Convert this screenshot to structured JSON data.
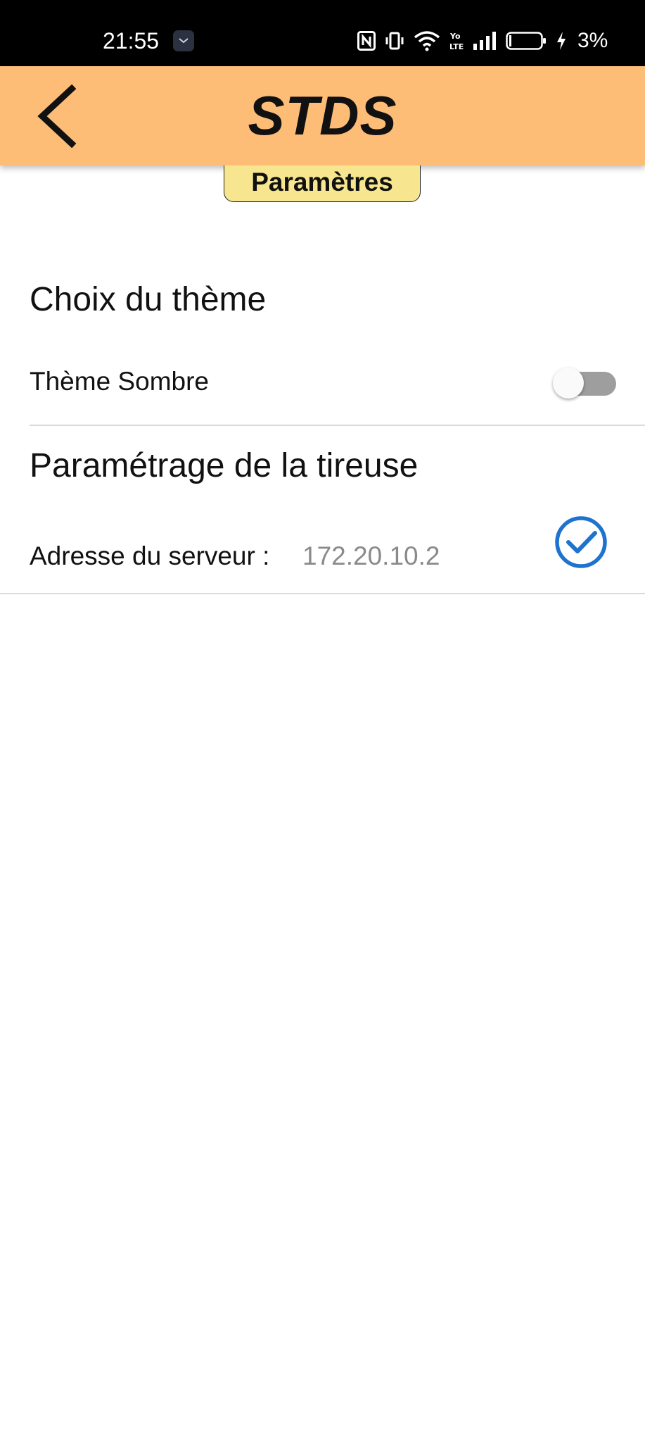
{
  "status_bar": {
    "time": "21:55",
    "battery_percent": "3%",
    "icons": [
      "notification-icon",
      "nfc-icon",
      "vibrate-icon",
      "wifi-icon",
      "volte-icon",
      "signal-icon",
      "battery-icon",
      "charging-icon"
    ]
  },
  "app_bar": {
    "title": "STDS",
    "back_icon": "chevron-left-icon",
    "background": "#fdbd77"
  },
  "page_tab": {
    "label": "Paramètres",
    "background": "#f7e68f"
  },
  "theme_section": {
    "title": "Choix du thème",
    "dark_theme_label": "Thème Sombre",
    "dark_theme_enabled": false
  },
  "tap_section": {
    "title": "Paramétrage de la tireuse",
    "server_label": "Adresse du serveur :",
    "server_value": "172.20.10.2",
    "confirm_icon": "check-circle-icon",
    "accent": "#1e73cf"
  }
}
